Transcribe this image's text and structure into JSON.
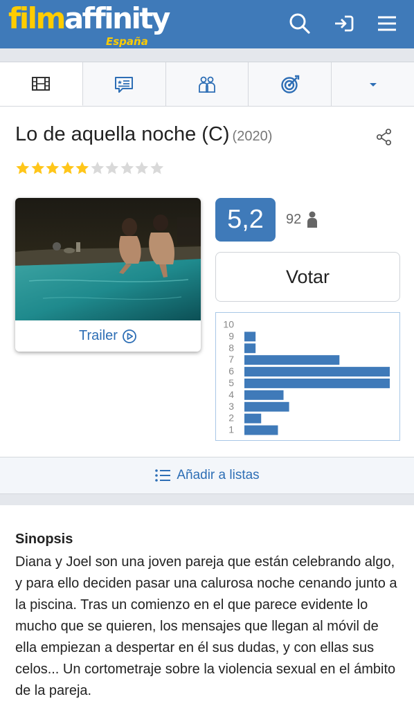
{
  "header": {
    "logo_part1": "film",
    "logo_part2": "affinity",
    "logo_region": "España",
    "icons": [
      "search-icon",
      "login-icon",
      "menu-icon"
    ],
    "brand_color": "#3f7ab9",
    "accent_color": "#ffcc00"
  },
  "tabs": [
    {
      "name": "film-icon",
      "active": true
    },
    {
      "name": "reviews-icon",
      "active": false
    },
    {
      "name": "friends-icon",
      "active": false
    },
    {
      "name": "target-icon",
      "active": false
    },
    {
      "name": "chevron-down-icon",
      "active": false
    }
  ],
  "movie": {
    "title": "Lo de aquella noche (C)",
    "year": "(2020)",
    "stars_filled": 5,
    "stars_total": 10
  },
  "poster": {
    "trailer_label": "Trailer"
  },
  "rating": {
    "score": "5,2",
    "votes": "92",
    "vote_label": "Votar"
  },
  "chart_data": {
    "type": "bar",
    "orientation": "horizontal",
    "categories": [
      "10",
      "9",
      "8",
      "7",
      "6",
      "5",
      "4",
      "3",
      "2",
      "1"
    ],
    "values": [
      0,
      2,
      2,
      17,
      26,
      26,
      7,
      8,
      3,
      6
    ],
    "bar_color": "#3f7ab9"
  },
  "lists": {
    "label": "Añadir a listas"
  },
  "synopsis": {
    "heading": "Sinopsis",
    "text": "Diana y Joel son una joven pareja que están celebrando algo, y para ello deciden pasar una calurosa noche cenando junto a la piscina. Tras un comienzo en el que parece evidente lo mucho que se quieren, los mensajes que llegan al móvil de ella empiezan a despertar en él sus dudas, y con ellas sus celos... Un cortometraje sobre la violencia sexual en el ámbito de la pareja."
  }
}
